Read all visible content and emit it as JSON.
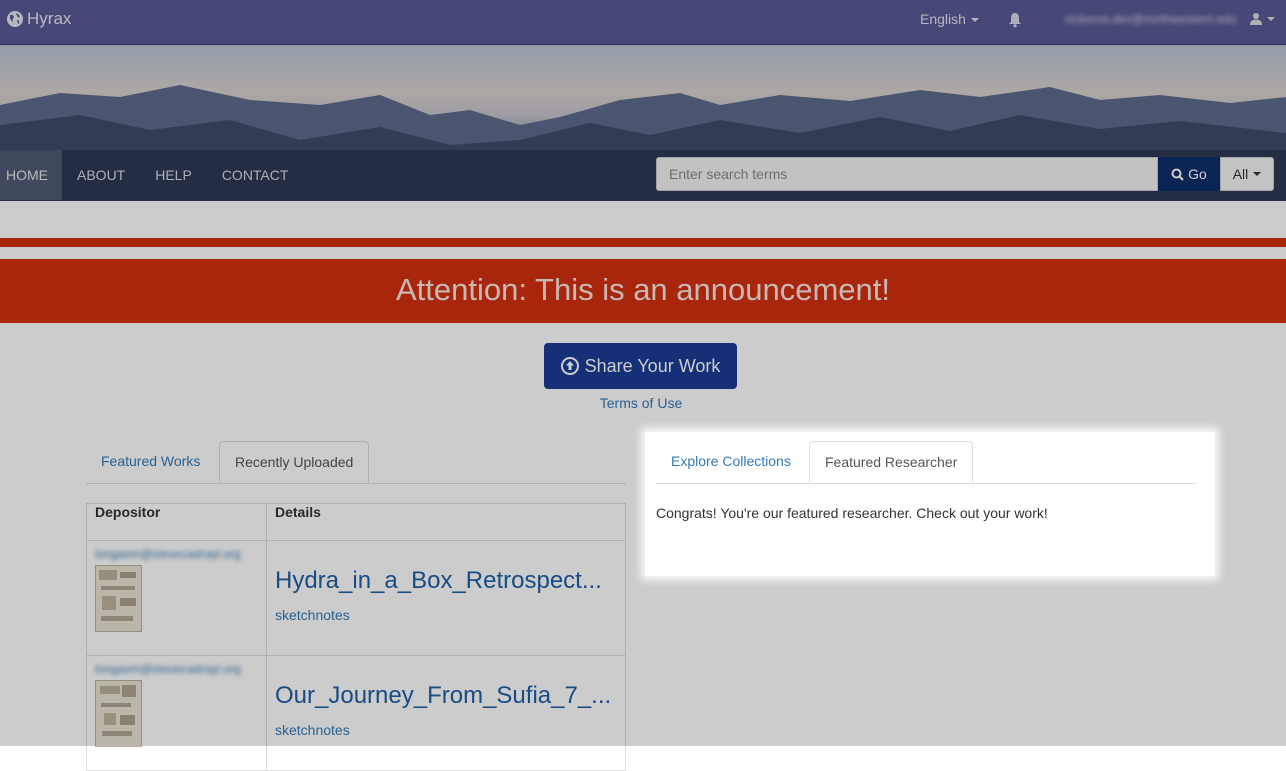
{
  "header": {
    "brand": "Hyrax",
    "language": "English",
    "user_email": "vickeros.dev@northwestern.edu"
  },
  "nav": {
    "items": [
      "HOME",
      "ABOUT",
      "HELP",
      "CONTACT"
    ]
  },
  "search": {
    "placeholder": "Enter search terms",
    "go_label": "Go",
    "scope": "All"
  },
  "announcement": {
    "text": "Attention: This is an announcement!"
  },
  "share": {
    "label": "Share Your Work",
    "terms": "Terms of Use"
  },
  "left_tabs": [
    "Featured Works",
    "Recently Uploaded"
  ],
  "table": {
    "headers": [
      "Depositor",
      "Details"
    ],
    "rows": [
      {
        "depositor": "longavm@stevecadrayl.org",
        "title": "Hydra_in_a_Box_Retrospect...",
        "keyword": "sketchnotes"
      },
      {
        "depositor": "longavm@stevecadrayl.org",
        "title": "Our_Journey_From_Sufia_7_...",
        "keyword": "sketchnotes"
      }
    ]
  },
  "right_tabs": [
    "Explore Collections",
    "Featured Researcher"
  ],
  "featured": {
    "message": "Congrats! You're our featured researcher. Check out your work!"
  },
  "colors": {
    "navbar": "#5a5a96",
    "announcement": "#d2310f",
    "primary_button": "#1c3d96",
    "link": "#337ab7"
  }
}
